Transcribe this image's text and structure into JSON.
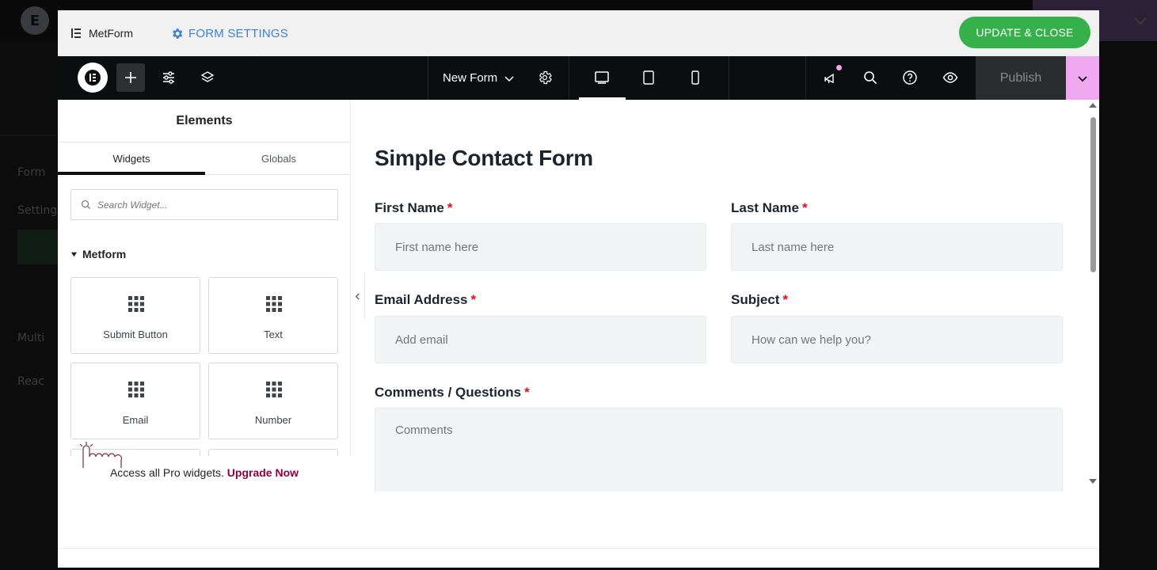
{
  "backdrop": {
    "logo_glyph": "E",
    "side_labels": [
      "Form",
      "Setting",
      "Multi",
      "Reac"
    ]
  },
  "modal_header": {
    "brand": "MetForm",
    "settings_label": "FORM SETTINGS",
    "update_close_label": "UPDATE & CLOSE",
    "accent_color": "#3b82d6",
    "update_color": "#36b04a"
  },
  "topbar": {
    "document_name": "New Form",
    "publish_label": "Publish",
    "icons": [
      "elementor-logo-icon",
      "add-element-icon",
      "settings-sliders-icon",
      "layers-icon",
      "chevron-down-icon",
      "gear-icon",
      "desktop-icon",
      "tablet-icon",
      "mobile-icon",
      "whats-new-icon",
      "search-icon",
      "help-icon",
      "preview-eye-icon",
      "chevron-down-icon"
    ],
    "publish_more_color": "#f0a8f0"
  },
  "panel": {
    "title": "Elements",
    "tabs": [
      {
        "label": "Widgets",
        "active": true
      },
      {
        "label": "Globals",
        "active": false
      }
    ],
    "search_placeholder": "Search Widget...",
    "category": "Metform",
    "widgets": [
      {
        "label": "Submit Button",
        "icon": "grid-icon"
      },
      {
        "label": "Text",
        "icon": "grid-icon"
      },
      {
        "label": "Email",
        "icon": "grid-icon"
      },
      {
        "label": "Number",
        "icon": "grid-icon"
      }
    ],
    "promo_text": "Access all Pro widgets.",
    "promo_link": "Upgrade Now"
  },
  "form": {
    "title": "Simple Contact Form",
    "required_mark": "*",
    "fields": {
      "first_name": {
        "label": "First Name",
        "placeholder": "First name here"
      },
      "last_name": {
        "label": "Last Name",
        "placeholder": "Last name here"
      },
      "email": {
        "label": "Email Address",
        "placeholder": "Add email"
      },
      "subject": {
        "label": "Subject",
        "placeholder": "How can we help you?"
      },
      "comments": {
        "label": "Comments / Questions",
        "placeholder": "Comments"
      }
    }
  }
}
